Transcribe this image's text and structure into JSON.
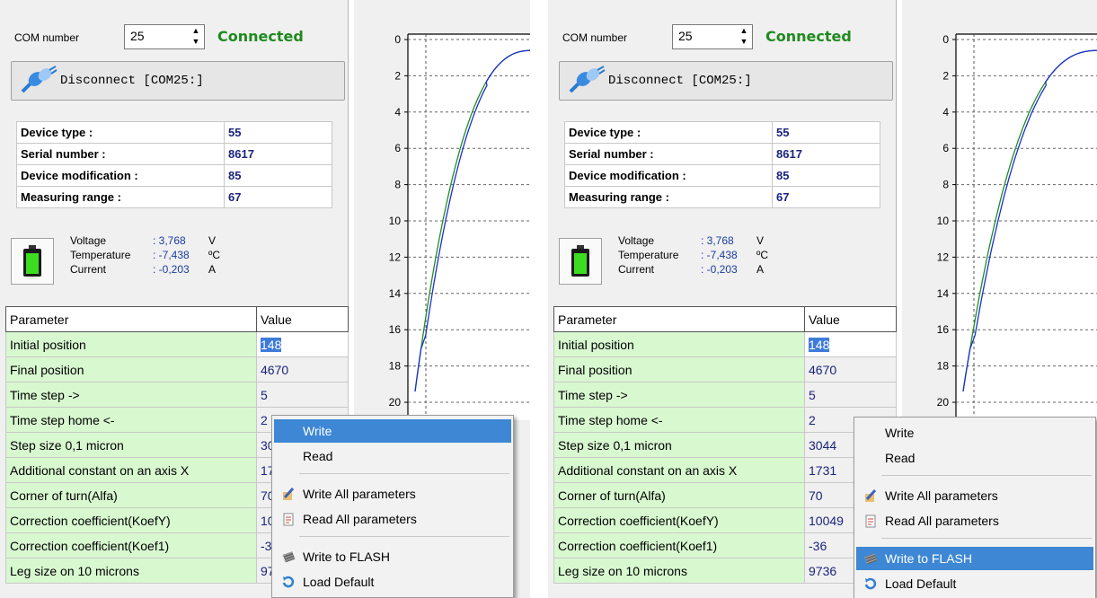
{
  "connection": {
    "com_label": "COM number",
    "com_value": "25",
    "status": "Connected",
    "disconnect_label": "Disconnect [COM25:]"
  },
  "device_info": [
    {
      "label": "Device type :",
      "value": "55"
    },
    {
      "label": "Serial number :",
      "value": "8617"
    },
    {
      "label": "Device modification :",
      "value": "85"
    },
    {
      "label": "Measuring range :",
      "value": "67"
    }
  ],
  "measurements": [
    {
      "label": "Voltage",
      "value": ": 3,768",
      "unit": "V"
    },
    {
      "label": "Temperature",
      "value": ": -7,438",
      "unit": "ºC"
    },
    {
      "label": "Current",
      "value": ": -0,203",
      "unit": "A"
    }
  ],
  "table": {
    "header_param": "Parameter",
    "header_value": "Value",
    "rows": [
      {
        "param": "Initial position",
        "value": "148"
      },
      {
        "param": "Final position",
        "value": "4670"
      },
      {
        "param": "Time  step ->",
        "value": "5"
      },
      {
        "param": "Time step home <-",
        "value": "2"
      },
      {
        "param": "Step size 0,1 micron",
        "value": "3044"
      },
      {
        "param": "Additional constant on an axis X",
        "value": "1731"
      },
      {
        "param": "Corner of turn(Alfa)",
        "value": "70"
      },
      {
        "param": "Correction coefficient(KoefY)",
        "value": "10049"
      },
      {
        "param": "Correction coefficient(Koef1)",
        "value": "-36"
      },
      {
        "param": "Leg size on 10 microns",
        "value": "9736"
      }
    ]
  },
  "left_table_partial_values": [
    "148",
    "4670",
    "5",
    "2",
    "30",
    "17",
    "70",
    "10",
    "-3",
    "97"
  ],
  "context_menu": {
    "write": "Write",
    "read": "Read",
    "write_all": "Write All parameters",
    "read_all": "Read All parameters",
    "write_flash": "Write to FLASH",
    "load_default": "Load Default"
  },
  "chart_data": {
    "type": "line",
    "y_ticks": [
      "0",
      "2",
      "4",
      "6",
      "8",
      "10",
      "12",
      "14",
      "16",
      "18",
      "20"
    ],
    "ylim": [
      0,
      20
    ],
    "y_inverted": true,
    "grid": true,
    "series": [
      {
        "color": "#1f8f1f"
      },
      {
        "color": "#1f2fd0"
      }
    ]
  },
  "colors": {
    "connected": "#1e8a1e",
    "row_green": "#d8f8d0",
    "highlight": "#3d87d4"
  }
}
